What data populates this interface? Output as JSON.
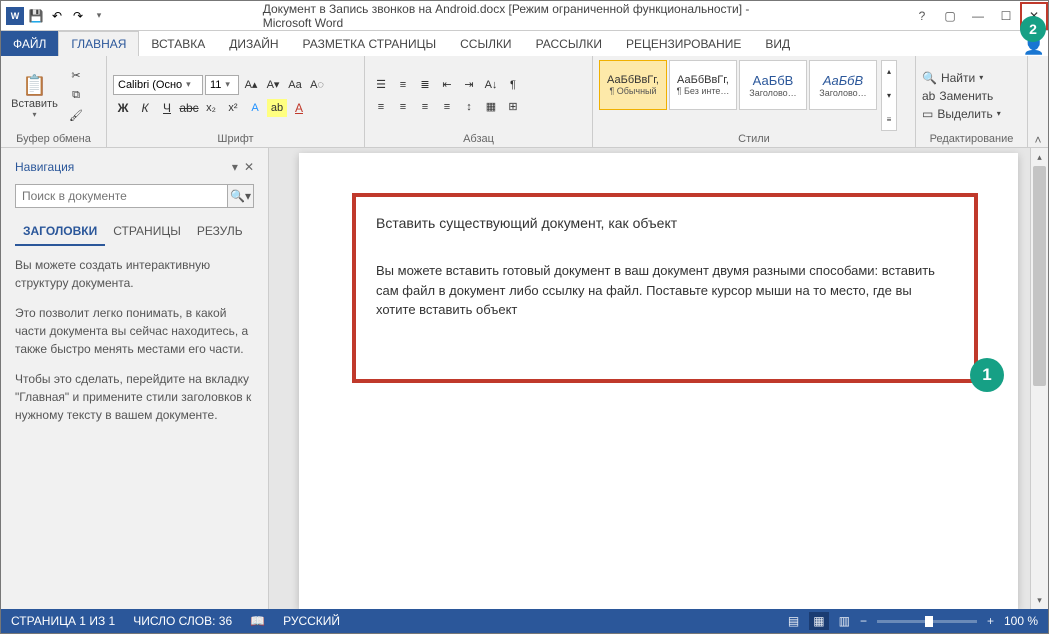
{
  "titlebar": {
    "title": "Документ в Запись звонков на Android.docx [Режим ограниченной функциональности] - Microsoft Word"
  },
  "badges": {
    "one": "1",
    "two": "2"
  },
  "tabs": {
    "file": "ФАЙЛ",
    "home": "ГЛАВНАЯ",
    "insert": "ВСТАВКА",
    "design": "ДИЗАЙН",
    "layout": "РАЗМЕТКА СТРАНИЦЫ",
    "refs": "ССЫЛКИ",
    "mailings": "РАССЫЛКИ",
    "review": "РЕЦЕНЗИРОВАНИЕ",
    "view": "ВИД"
  },
  "ribbon": {
    "clipboard": {
      "label": "Буфер обмена",
      "paste": "Вставить"
    },
    "font": {
      "label": "Шрифт",
      "name": "Calibri (Осно",
      "size": "11"
    },
    "paragraph": {
      "label": "Абзац"
    },
    "styles": {
      "label": "Стили",
      "items": [
        {
          "sample": "АаБбВвГг,",
          "name": "¶ Обычный"
        },
        {
          "sample": "АаБбВвГг,",
          "name": "¶ Без инте…"
        },
        {
          "sample": "АаБбВ",
          "name": "Заголово…"
        },
        {
          "sample": "АаБбВ",
          "name": "Заголово…"
        }
      ]
    },
    "editing": {
      "label": "Редактирование",
      "find": "Найти",
      "replace": "Заменить",
      "select": "Выделить"
    }
  },
  "nav": {
    "title": "Навигация",
    "search_placeholder": "Поиск в документе",
    "tabs": {
      "headings": "ЗАГОЛОВКИ",
      "pages": "СТРАНИЦЫ",
      "results": "РЕЗУЛЬ"
    },
    "help": {
      "p1": "Вы можете создать интерактивную структуру документа.",
      "p2": "Это позволит легко понимать, в какой части документа вы сейчас находитесь, а также быстро менять местами его части.",
      "p3": "Чтобы это сделать, перейдите на вкладку \"Главная\" и примените стили заголовков к нужному тексту в вашем документе."
    }
  },
  "document": {
    "heading": "Вставить существующий документ, как объект",
    "body": "Вы можете вставить готовый документ в ваш документ двумя разными способами: вставить сам файл в документ либо ссылку на файл. Поставьте курсор мыши на то место, где вы хотите вставить объект"
  },
  "status": {
    "page": "СТРАНИЦА 1 ИЗ 1",
    "words": "ЧИСЛО СЛОВ: 36",
    "lang": "РУССКИЙ",
    "zoom": "100 %"
  }
}
